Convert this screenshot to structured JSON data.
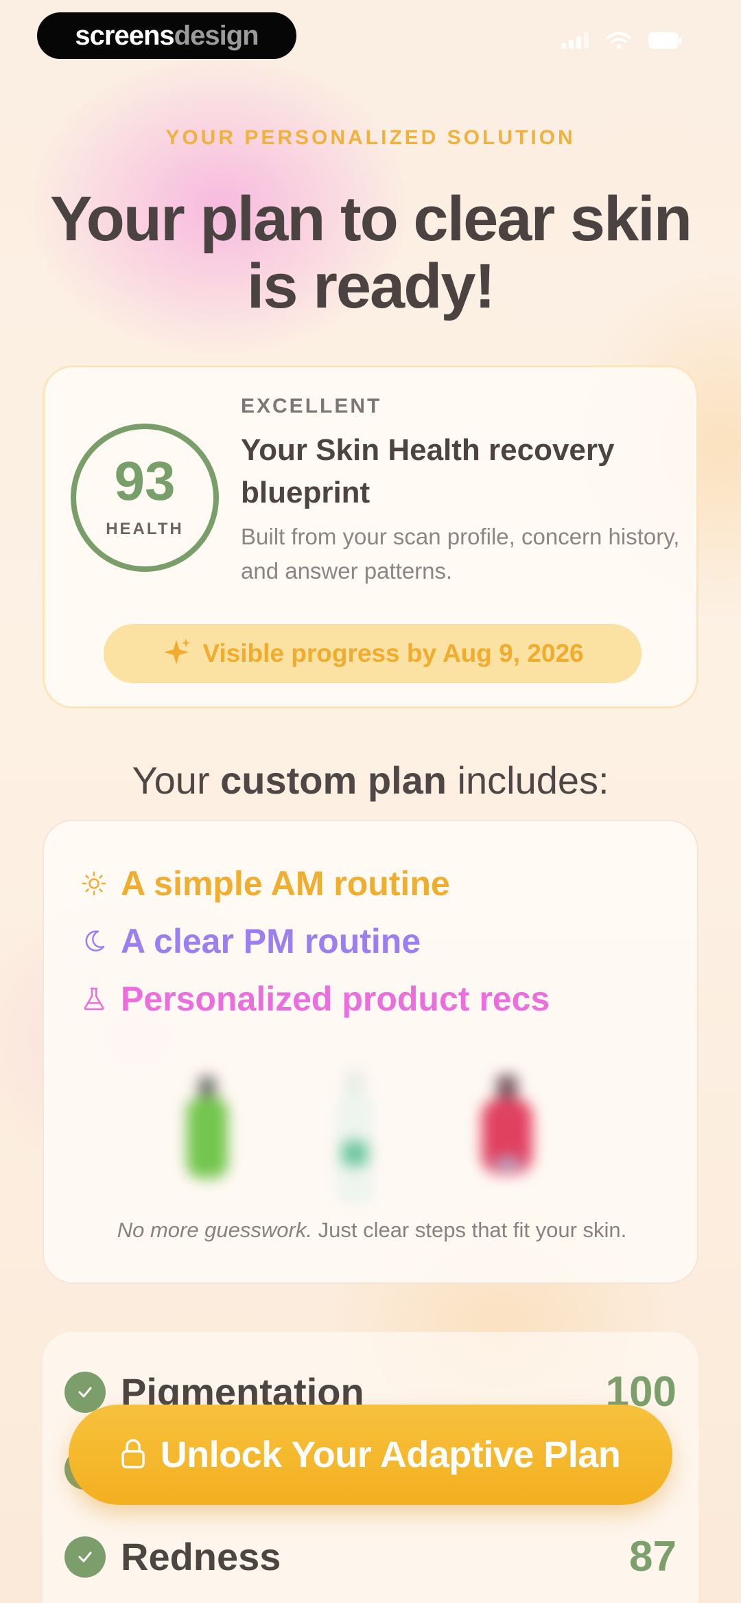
{
  "branding": {
    "logo_part1": "screens",
    "logo_part2": "design"
  },
  "header": {
    "eyebrow": "YOUR PERSONALIZED SOLUTION",
    "title": "Your plan to clear skin is ready!"
  },
  "score_card": {
    "score": "93",
    "score_label": "HEALTH",
    "rating": "EXCELLENT",
    "title": "Your Skin Health recovery blueprint",
    "description": "Built from your scan profile, concern history, and answer patterns.",
    "progress": "Visible progress by Aug 9, 2026"
  },
  "includes": {
    "prefix": "Your ",
    "bold": "custom plan",
    "suffix": " includes:"
  },
  "plan": {
    "items": [
      {
        "label": "A simple AM routine",
        "icon": "sun-icon",
        "color": "#f0ad2e"
      },
      {
        "label": "A clear PM routine",
        "icon": "moon-icon",
        "color": "#9b7ef0"
      },
      {
        "label": "Personalized product recs",
        "icon": "flask-icon",
        "color": "#ea6fdc"
      }
    ],
    "tagline_italic": "No more guesswork.",
    "tagline_rest": " Just clear steps that fit your skin."
  },
  "concerns": [
    {
      "name": "Pigmentation",
      "score": "100"
    },
    {
      "name": "Redness",
      "score": "87"
    }
  ],
  "cta": {
    "label": "Unlock Your Adaptive Plan"
  },
  "colors": {
    "accent": "#f3b01f",
    "health_green": "#7a9e6a",
    "text_dark": "#4b4341"
  }
}
